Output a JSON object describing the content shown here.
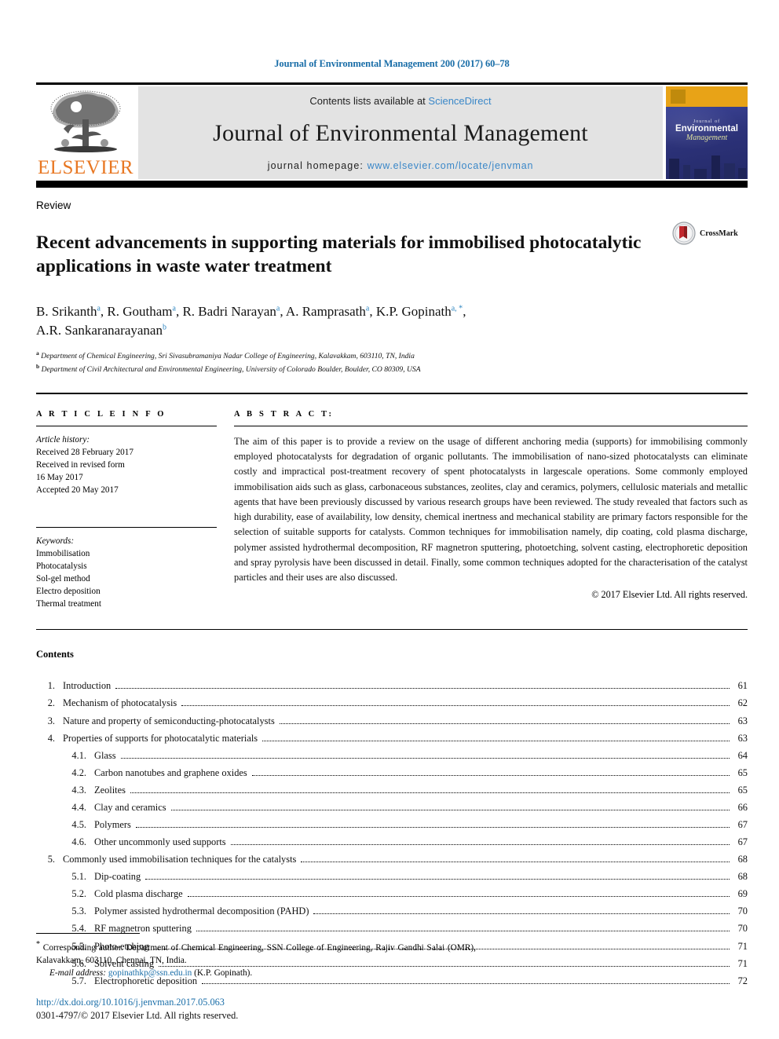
{
  "running_head": "Journal of Environmental Management 200 (2017) 60–78",
  "masthead": {
    "publisher_logo_label": "ELSEVIER",
    "contents_prefix": "Contents lists available at ",
    "sciencedirect": "ScienceDirect",
    "journal_title": "Journal of Environmental Management",
    "homepage_prefix": "journal homepage: ",
    "homepage_url": "www.elsevier.com/locate/jenvman",
    "cover": {
      "kicker": "Journal of",
      "line1": "Environmental",
      "line2": "Management"
    },
    "link_color": "#3a87c8",
    "elsevier_orange": "#E87722"
  },
  "article": {
    "doctype": "Review",
    "title": "Recent advancements in supporting materials for immobilised photocatalytic applications in waste water treatment",
    "crossmark_label": "CrossMark",
    "authors_line1": "B. Srikanth ",
    "authors": [
      {
        "name": "B. Srikanth",
        "marks": "a"
      },
      {
        "name": "R. Goutham",
        "marks": "a"
      },
      {
        "name": "R. Badri Narayan",
        "marks": "a"
      },
      {
        "name": "A. Ramprasath",
        "marks": "a"
      },
      {
        "name": "K.P. Gopinath",
        "marks": "a, *"
      },
      {
        "name": "A.R. Sankaranarayanan",
        "marks": "b"
      }
    ],
    "affiliations": [
      {
        "mark": "a",
        "text": "Department of Chemical Engineering, Sri Sivasubramaniya Nadar College of Engineering, Kalavakkam, 603110, TN, India"
      },
      {
        "mark": "b",
        "text": "Department of Civil Architectural and Environmental Engineering, University of Colorado Boulder, Boulder, CO 80309, USA"
      }
    ]
  },
  "article_info": {
    "heading": "A R T I C L E  I N F O",
    "history_label": "Article history:",
    "history": [
      "Received 28 February 2017",
      "Received in revised form",
      "16 May 2017",
      "Accepted 20 May 2017"
    ],
    "keywords_label": "Keywords:",
    "keywords": [
      "Immobilisation",
      "Photocatalysis",
      "Sol-gel method",
      "Electro deposition",
      "Thermal treatment"
    ]
  },
  "abstract": {
    "heading": "A B S T R A C T",
    "body": "The aim of this paper is to provide a review on the usage of different anchoring media (supports) for immobilising commonly employed photocatalysts for degradation of organic pollutants. The immobilisation of nano-sized photocatalysts can eliminate costly and impractical post-treatment recovery of spent photocatalysts in largescale operations. Some commonly employed immobilisation aids such as glass, carbonaceous substances, zeolites, clay and ceramics, polymers, cellulosic materials and metallic agents that have been previously discussed by various research groups have been reviewed. The study revealed that factors such as high durability, ease of availability, low density, chemical inertness and mechanical stability are primary factors responsible for the selection of suitable supports for catalysts. Common techniques for immobilisation namely, dip coating, cold plasma discharge, polymer assisted hydrothermal decomposition, RF magnetron sputtering, photoetching, solvent casting, electrophoretic deposition and spray pyrolysis have been discussed in detail. Finally, some common techniques adopted for the characterisation of the catalyst particles and their uses are also discussed.",
    "copyright": "© 2017 Elsevier Ltd. All rights reserved."
  },
  "contents": {
    "heading": "Contents",
    "entries": [
      {
        "num": "1.",
        "label": "Introduction",
        "page": "61",
        "level": 1
      },
      {
        "num": "2.",
        "label": "Mechanism of photocatalysis",
        "page": "62",
        "level": 1
      },
      {
        "num": "3.",
        "label": "Nature and property of semiconducting-photocatalysts",
        "page": "63",
        "level": 1
      },
      {
        "num": "4.",
        "label": "Properties of supports for photocatalytic materials",
        "page": "63",
        "level": 1
      },
      {
        "num": "4.1.",
        "label": "Glass",
        "page": "64",
        "level": 2
      },
      {
        "num": "4.2.",
        "label": "Carbon nanotubes and graphene oxides",
        "page": "65",
        "level": 2
      },
      {
        "num": "4.3.",
        "label": "Zeolites",
        "page": "65",
        "level": 2
      },
      {
        "num": "4.4.",
        "label": "Clay and ceramics",
        "page": "66",
        "level": 2
      },
      {
        "num": "4.5.",
        "label": "Polymers",
        "page": "67",
        "level": 2
      },
      {
        "num": "4.6.",
        "label": "Other uncommonly used supports",
        "page": "67",
        "level": 2
      },
      {
        "num": "5.",
        "label": "Commonly used immobilisation techniques for the catalysts",
        "page": "68",
        "level": 1
      },
      {
        "num": "5.1.",
        "label": "Dip-coating",
        "page": "68",
        "level": 2
      },
      {
        "num": "5.2.",
        "label": "Cold plasma discharge",
        "page": "69",
        "level": 2
      },
      {
        "num": "5.3.",
        "label": "Polymer assisted hydrothermal decomposition (PAHD)",
        "page": "70",
        "level": 2
      },
      {
        "num": "5.4.",
        "label": "RF magnetron sputtering",
        "page": "70",
        "level": 2
      },
      {
        "num": "5.5.",
        "label": "Photo-etching",
        "page": "71",
        "level": 2
      },
      {
        "num": "5.6.",
        "label": "Solvent casting",
        "page": "71",
        "level": 2
      },
      {
        "num": "5.7.",
        "label": "Electrophoretic deposition",
        "page": "72",
        "level": 2
      }
    ]
  },
  "footer": {
    "corresponding": "Corresponding author. Department of Chemical Engineering, SSN College of Engineering, Rajiv Gandhi Salai (OMR), Kalavakkam, 603110, Chennai, TN, India.",
    "email_label": "E-mail address:",
    "email": "gopinathkp@ssn.edu.in",
    "email_owner": "(K.P. Gopinath).",
    "doi": "http://dx.doi.org/10.1016/j.jenvman.2017.05.063",
    "issn_line": "0301-4797/© 2017 Elsevier Ltd. All rights reserved.",
    "link_color": "#1a6ea8"
  }
}
